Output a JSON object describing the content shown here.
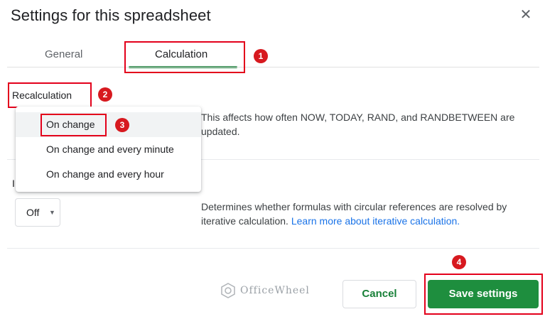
{
  "dialog": {
    "title": "Settings for this spreadsheet",
    "close_icon": "close-icon",
    "close_glyph": "✕"
  },
  "tabs": [
    {
      "label": "General",
      "selected": false
    },
    {
      "label": "Calculation",
      "selected": true
    }
  ],
  "recalculation": {
    "label": "Recalculation",
    "options": [
      "On change",
      "On change and every minute",
      "On change and every hour"
    ],
    "selected": "On change",
    "description": "This affects how often NOW, TODAY, RAND, and RANDBETWEEN are updated."
  },
  "iterative": {
    "label_fragment": "I",
    "select_value": "Off",
    "caret_glyph": "▼",
    "description": "Determines whether formulas with circular references are resolved by iterative calculation.",
    "link_text": "Learn more about iterative calculation."
  },
  "annotations": [
    "1",
    "2",
    "3",
    "4"
  ],
  "annotation_color": "#e3001b",
  "watermark": "OfficeWheel",
  "buttons": {
    "cancel": "Cancel",
    "save": "Save settings"
  },
  "colors": {
    "accent_green": "#188038",
    "save_bg": "#1e8e3e",
    "link_blue": "#1a73e8"
  }
}
